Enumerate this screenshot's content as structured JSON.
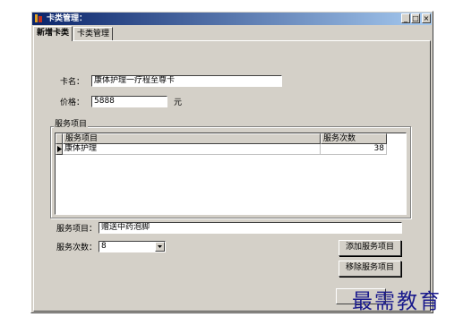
{
  "window": {
    "title": "卡类管理：",
    "controls": {
      "minimize": "_",
      "maximize": "□",
      "close": "×"
    }
  },
  "tabs": [
    {
      "label": "新增卡类",
      "active": true
    },
    {
      "label": "卡类管理",
      "active": false
    }
  ],
  "form": {
    "card_name_label": "卡名：",
    "card_name_value": "康体护理一疗程至尊卡",
    "price_label": "价格：",
    "price_value": "5888",
    "price_unit": "元"
  },
  "services_group": {
    "caption": "服务项目",
    "columns": [
      "服务项目",
      "服务次数"
    ],
    "rows": [
      {
        "item": "康体护理",
        "count": "38"
      }
    ]
  },
  "service_item": {
    "label": "服务项目：",
    "value": "赠送中药泡脚"
  },
  "service_count": {
    "label": "服务次数：",
    "value": "8"
  },
  "buttons": {
    "add": "添加服务项目",
    "remove": "移除服务项目"
  },
  "watermark": "最需教育",
  "icons": [
    "app-icon",
    "combo-arrow-icon",
    "row-indicator-icon"
  ]
}
